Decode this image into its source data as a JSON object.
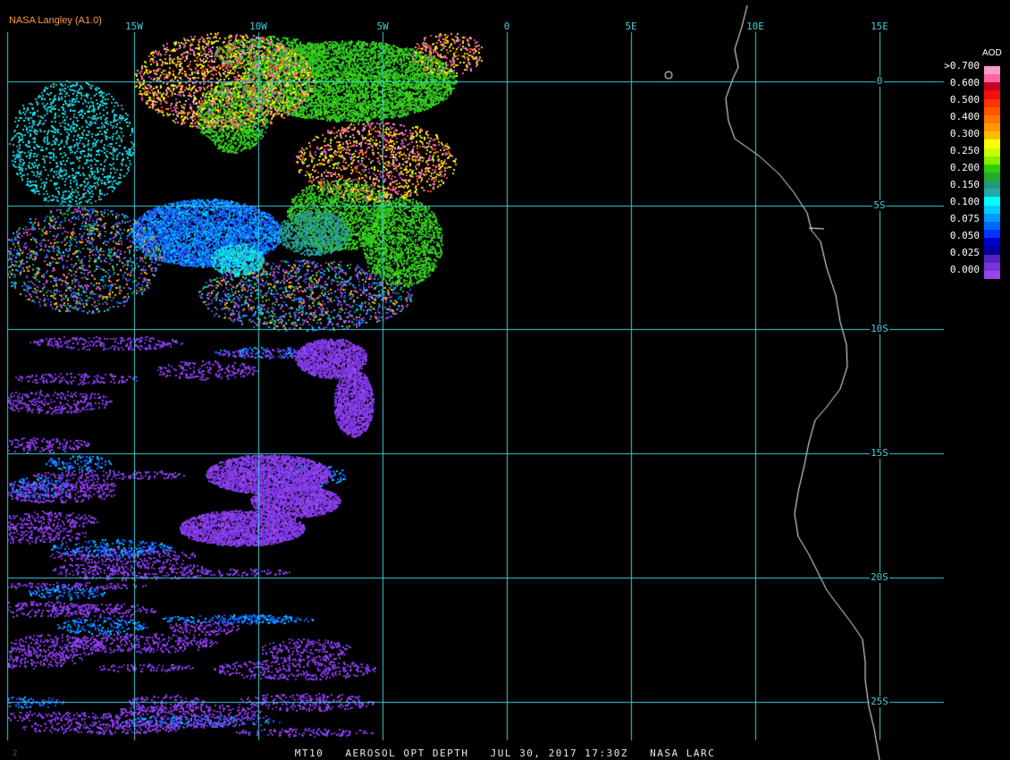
{
  "credit": "NASA Langley (A1.0)",
  "footer": {
    "product": "MT10",
    "parameter": "AEROSOL OPT DEPTH",
    "datetime": "JUL 30, 2017 17:30Z",
    "source": "NASA LARC"
  },
  "corner_mark": "2",
  "longitude_labels": [
    "15W",
    "10W",
    "5W",
    "0",
    "5E",
    "10E",
    "15E"
  ],
  "latitude_labels": [
    "0",
    "5S",
    "10S",
    "15S",
    "20S",
    "25S"
  ],
  "legend": {
    "title": "AOD",
    "labels": [
      ">0.700",
      "0.600",
      "0.500",
      "0.400",
      "0.300",
      "0.250",
      "0.200",
      "0.150",
      "0.100",
      "0.075",
      "0.050",
      "0.025",
      "0.000"
    ],
    "colors": [
      "#ff99cc",
      "#ff66aa",
      "#cc0022",
      "#ee1111",
      "#ff3300",
      "#ff5500",
      "#ff7700",
      "#ff9900",
      "#ffbb00",
      "#ffff00",
      "#ccff00",
      "#88ee00",
      "#33cc00",
      "#22aa33",
      "#229977",
      "#22aaaa",
      "#00ffff",
      "#00ccff",
      "#0099ff",
      "#0066ff",
      "#0033ff",
      "#0000cc",
      "#000099",
      "#5522bb",
      "#7733dd",
      "#9944ee"
    ]
  },
  "colors": {
    "background": "#000000",
    "grid": "#3fd0d8",
    "coastline": "#ffffff",
    "credit": "#ff9a3c"
  }
}
